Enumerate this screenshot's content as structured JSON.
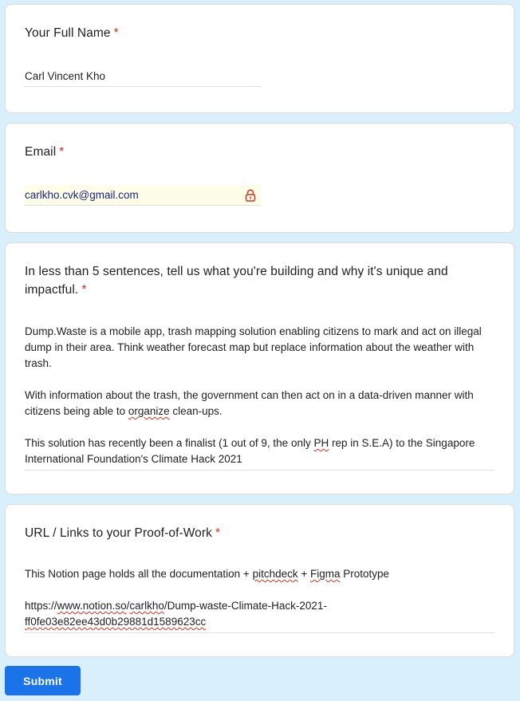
{
  "questions": [
    {
      "title": "Your Full Name",
      "required_mark": "*",
      "answer": "Carl Vincent Kho"
    },
    {
      "title": "Email",
      "required_mark": "*",
      "answer": "carlkho.cvk@gmail.com",
      "answer_icon": "lock-icon"
    },
    {
      "title": "In less than 5 sentences, tell us what you're building and why it's unique and impactful.",
      "required_mark": "*",
      "answer_paragraphs": {
        "p1": "Dump.Waste is a mobile app, trash mapping solution enabling citizens to mark and act on illegal dump in their area. Think weather forecast map but replace information about the weather with trash.",
        "p2_before": "With information about the trash, the government can then act on in a data-driven manner with citizens being able to ",
        "p2_flagged": "organize",
        "p2_after": " clean-ups.",
        "p3_before": "This solution has recently been a finalist (1 out of 9, the only ",
        "p3_flagged": "PH",
        "p3_after": " rep in S.E.A) to the Singapore International Foundation's Climate Hack 2021"
      }
    },
    {
      "title": "URL / Links to your Proof-of-Work",
      "required_mark": "*",
      "answer_paragraphs": {
        "p1_before": "This Notion page holds all the documentation + ",
        "p1_flagged_1": "pitchdeck",
        "p1_mid": " + ",
        "p1_flagged_2": "Figma",
        "p1_after": " Prototype",
        "url_1": "https://",
        "url_2": "www.notion.so",
        "url_3": "/",
        "url_4": "carlkho",
        "url_5": "/Dump-waste-Climate-Hack-2021-",
        "url_6": "ff0fe03e82ee43d0b29881d1589623cc"
      }
    }
  ],
  "submit_label": "Submit",
  "colors": {
    "background": "#d9effc",
    "card": "#ffffff",
    "required": "#d93025",
    "submit": "#1a73e8",
    "autofill": "#fefde8"
  }
}
